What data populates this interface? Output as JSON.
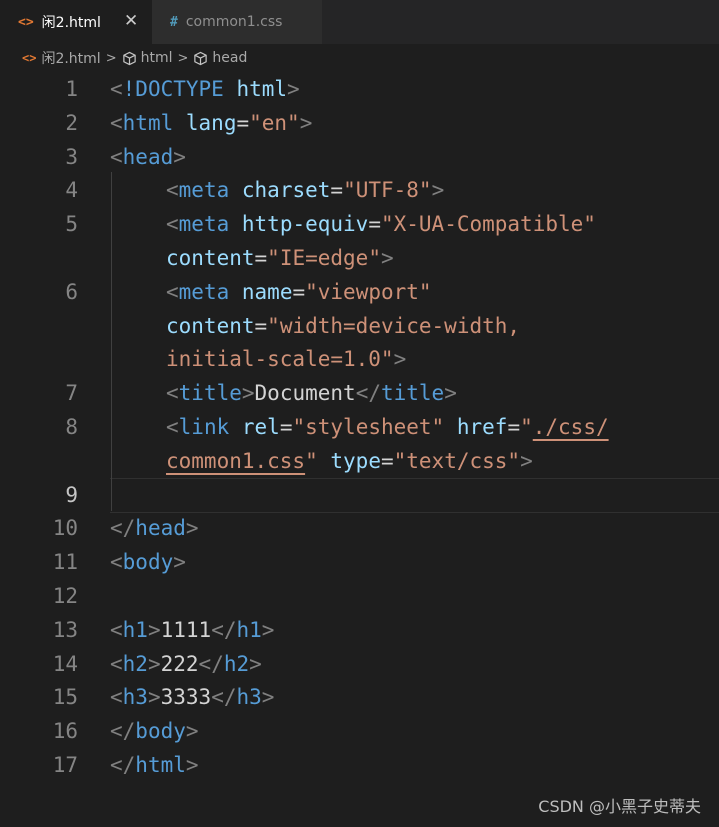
{
  "tabs": [
    {
      "label": "闲2.html",
      "icon": "<>",
      "active": true,
      "close": "✕"
    },
    {
      "label": "common1.css",
      "icon": "#",
      "active": false
    }
  ],
  "breadcrumb": {
    "file": "闲2.html",
    "items": [
      "html",
      "head"
    ],
    "separator": ">"
  },
  "editor": {
    "current_line": 9,
    "lines": [
      {
        "n": "1",
        "tokens": [
          [
            "p",
            "<"
          ],
          [
            "t",
            "!DOCTYPE"
          ],
          [
            "x",
            " "
          ],
          [
            "a",
            "html"
          ],
          [
            "p",
            ">"
          ]
        ]
      },
      {
        "n": "2",
        "tokens": [
          [
            "p",
            "<"
          ],
          [
            "t",
            "html"
          ],
          [
            "x",
            " "
          ],
          [
            "a",
            "lang"
          ],
          [
            "x",
            "="
          ],
          [
            "s",
            "\"en\""
          ],
          [
            "p",
            ">"
          ]
        ]
      },
      {
        "n": "3",
        "tokens": [
          [
            "p",
            "<"
          ],
          [
            "t",
            "head"
          ],
          [
            "p",
            ">"
          ]
        ]
      },
      {
        "n": "4",
        "indent": true,
        "tokens": [
          [
            "p",
            "<"
          ],
          [
            "t",
            "meta"
          ],
          [
            "x",
            " "
          ],
          [
            "a",
            "charset"
          ],
          [
            "x",
            "="
          ],
          [
            "s",
            "\"UTF-8\""
          ],
          [
            "p",
            ">"
          ]
        ]
      },
      {
        "n": "5",
        "indent": true,
        "tokens": [
          [
            "p",
            "<"
          ],
          [
            "t",
            "meta"
          ],
          [
            "x",
            " "
          ],
          [
            "a",
            "http-equiv"
          ],
          [
            "x",
            "="
          ],
          [
            "s",
            "\"X-UA-Compatible\""
          ]
        ]
      },
      {
        "n": "",
        "indent": true,
        "tokens": [
          [
            "a",
            "content"
          ],
          [
            "x",
            "="
          ],
          [
            "s",
            "\"IE=edge\""
          ],
          [
            "p",
            ">"
          ]
        ]
      },
      {
        "n": "6",
        "indent": true,
        "tokens": [
          [
            "p",
            "<"
          ],
          [
            "t",
            "meta"
          ],
          [
            "x",
            " "
          ],
          [
            "a",
            "name"
          ],
          [
            "x",
            "="
          ],
          [
            "s",
            "\"viewport\""
          ]
        ]
      },
      {
        "n": "",
        "indent": true,
        "tokens": [
          [
            "a",
            "content"
          ],
          [
            "x",
            "="
          ],
          [
            "s",
            "\"width=device-width,"
          ]
        ]
      },
      {
        "n": "",
        "indent": true,
        "tokens": [
          [
            "s",
            "initial-scale=1.0\""
          ],
          [
            "p",
            ">"
          ]
        ]
      },
      {
        "n": "7",
        "indent": true,
        "tokens": [
          [
            "p",
            "<"
          ],
          [
            "t",
            "title"
          ],
          [
            "p",
            ">"
          ],
          [
            "x",
            "Document"
          ],
          [
            "p",
            "</"
          ],
          [
            "t",
            "title"
          ],
          [
            "p",
            ">"
          ]
        ]
      },
      {
        "n": "8",
        "indent": true,
        "tokens": [
          [
            "p",
            "<"
          ],
          [
            "t",
            "link"
          ],
          [
            "x",
            " "
          ],
          [
            "a",
            "rel"
          ],
          [
            "x",
            "="
          ],
          [
            "s",
            "\"stylesheet\""
          ],
          [
            "x",
            " "
          ],
          [
            "a",
            "href"
          ],
          [
            "x",
            "="
          ],
          [
            "s",
            "\""
          ],
          [
            "su",
            "./css/"
          ]
        ]
      },
      {
        "n": "",
        "indent": true,
        "tokens": [
          [
            "su",
            "common1.css"
          ],
          [
            "s",
            "\""
          ],
          [
            "x",
            " "
          ],
          [
            "a",
            "type"
          ],
          [
            "x",
            "="
          ],
          [
            "s",
            "\"text/css\""
          ],
          [
            "p",
            ">"
          ]
        ]
      },
      {
        "n": "9",
        "indent": true,
        "tokens": []
      },
      {
        "n": "10",
        "tokens": [
          [
            "p",
            "</"
          ],
          [
            "t",
            "head"
          ],
          [
            "p",
            ">"
          ]
        ]
      },
      {
        "n": "11",
        "tokens": [
          [
            "p",
            "<"
          ],
          [
            "t",
            "body"
          ],
          [
            "p",
            ">"
          ]
        ]
      },
      {
        "n": "12",
        "tokens": []
      },
      {
        "n": "13",
        "tokens": [
          [
            "p",
            "<"
          ],
          [
            "t",
            "h1"
          ],
          [
            "p",
            ">"
          ],
          [
            "x",
            "1111"
          ],
          [
            "p",
            "</"
          ],
          [
            "t",
            "h1"
          ],
          [
            "p",
            ">"
          ]
        ]
      },
      {
        "n": "14",
        "tokens": [
          [
            "p",
            "<"
          ],
          [
            "t",
            "h2"
          ],
          [
            "p",
            ">"
          ],
          [
            "x",
            "222"
          ],
          [
            "p",
            "</"
          ],
          [
            "t",
            "h2"
          ],
          [
            "p",
            ">"
          ]
        ]
      },
      {
        "n": "15",
        "tokens": [
          [
            "p",
            "<"
          ],
          [
            "t",
            "h3"
          ],
          [
            "p",
            ">"
          ],
          [
            "x",
            "3333"
          ],
          [
            "p",
            "</"
          ],
          [
            "t",
            "h3"
          ],
          [
            "p",
            ">"
          ]
        ]
      },
      {
        "n": "16",
        "tokens": [
          [
            "p",
            "</"
          ],
          [
            "t",
            "body"
          ],
          [
            "p",
            ">"
          ]
        ]
      },
      {
        "n": "17",
        "tokens": [
          [
            "p",
            "</"
          ],
          [
            "t",
            "html"
          ],
          [
            "p",
            ">"
          ]
        ]
      }
    ]
  },
  "watermark": "CSDN @小黑子史蒂夫",
  "colors": {
    "background": "#1e1e1e",
    "tag": "#569cd6",
    "attribute": "#9cdcfe",
    "string": "#ce9178",
    "punctuation": "#808080",
    "html_file_icon": "#e37933",
    "css_file_icon": "#519aba"
  }
}
